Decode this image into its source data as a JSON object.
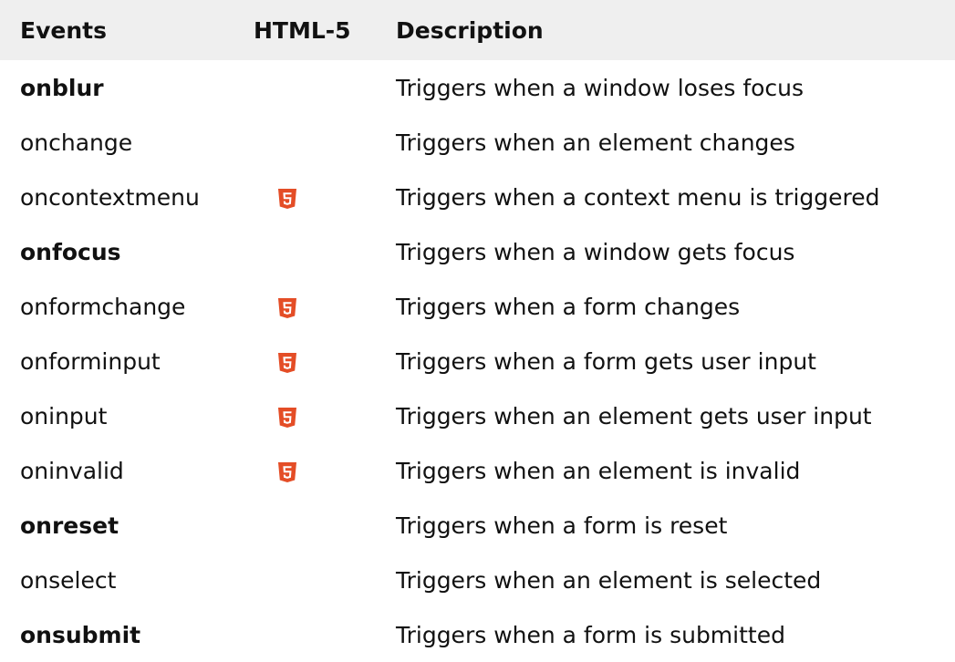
{
  "table": {
    "headers": {
      "events": "Events",
      "html5": "HTML-5",
      "description": "Description"
    },
    "html5_icon": "html5-shield-icon",
    "html5_color": "#e44d26",
    "rows": [
      {
        "event": "onblur",
        "bold": true,
        "html5": false,
        "description": "Triggers when a window loses focus"
      },
      {
        "event": "onchange",
        "bold": false,
        "html5": false,
        "description": "Triggers when an element changes"
      },
      {
        "event": "oncontextmenu",
        "bold": false,
        "html5": true,
        "description": "Triggers when a context menu is triggered"
      },
      {
        "event": "onfocus",
        "bold": true,
        "html5": false,
        "description": "Triggers when a window gets focus"
      },
      {
        "event": "onformchange",
        "bold": false,
        "html5": true,
        "description": "Triggers when a form changes"
      },
      {
        "event": "onforminput",
        "bold": false,
        "html5": true,
        "description": "Triggers when a form gets user input"
      },
      {
        "event": "oninput",
        "bold": false,
        "html5": true,
        "description": "Triggers when an element gets user input"
      },
      {
        "event": "oninvalid",
        "bold": false,
        "html5": true,
        "description": "Triggers when an element is invalid"
      },
      {
        "event": "onreset",
        "bold": true,
        "html5": false,
        "description": "Triggers when a form is reset"
      },
      {
        "event": "onselect",
        "bold": false,
        "html5": false,
        "description": "Triggers when an element is selected"
      },
      {
        "event": "onsubmit",
        "bold": true,
        "html5": false,
        "description": "Triggers when a form is submitted"
      }
    ]
  }
}
